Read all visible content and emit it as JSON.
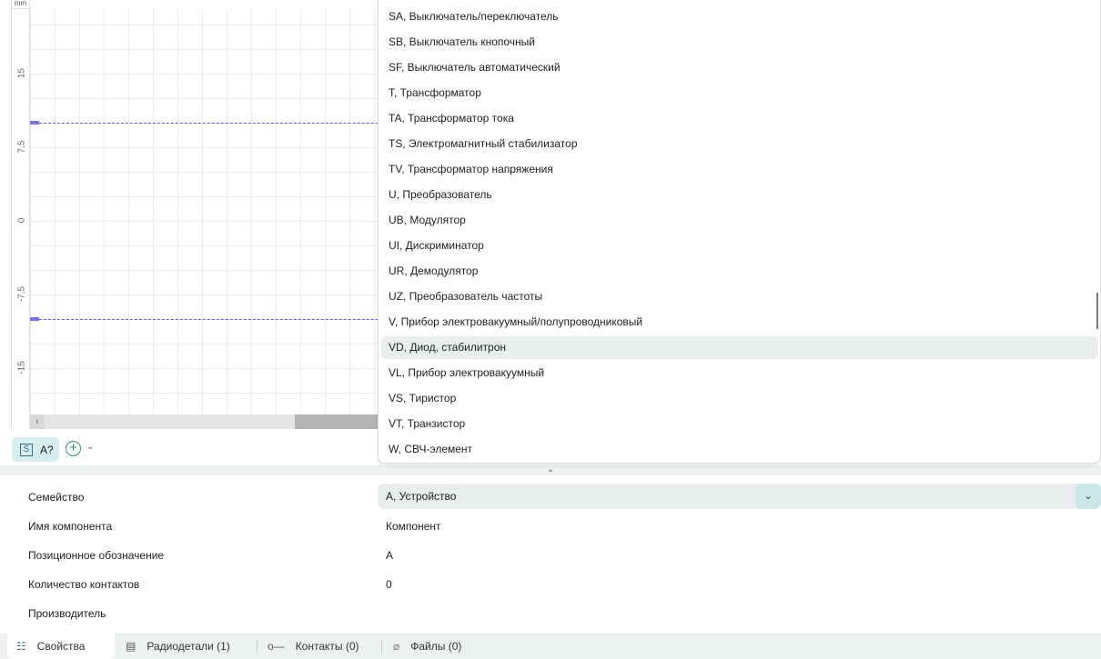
{
  "ruler": {
    "unit": "mm",
    "labels": [
      "15",
      "7,5",
      "0",
      "-7,5",
      "-15"
    ]
  },
  "toolbar": {
    "chip_icon": "S",
    "chip_label": "A?",
    "add_icon": "plus-circle-icon",
    "dropdown_icon": "chevron-down-icon"
  },
  "dropdown": {
    "items": [
      "SA, Выключатель/переключатель",
      "SB, Выключатель кнопочный",
      "SF, Выключатель автоматический",
      "T, Трансформатор",
      "TA, Трансформатор тока",
      "TS, Электромагнитный стабилизатор",
      "TV, Трансформатор напряжения",
      "U, Преобразователь",
      "UB, Модулятор",
      "UI, Дискриминатор",
      "UR, Демодулятор",
      "UZ, Преобразователь частоты",
      "V, Прибор электровакуумный/полупроводниковый",
      "VD, Диод, стабилитрон",
      "VL, Прибор электровакуумный",
      "VS, Тиристор",
      "VT, Транзистор",
      "W, СВЧ-элемент"
    ],
    "highlighted": "VD, Диод, стабилитрон"
  },
  "properties": {
    "family_label": "Семейство",
    "family_value": "А, Устройство",
    "name_label": "Имя компонента",
    "name_value": "Компонент",
    "designator_label": "Позиционное обозначение",
    "designator_value": "А",
    "pins_label": "Количество контактов",
    "pins_value": "0",
    "manufacturer_label": "Производитель",
    "manufacturer_value": ""
  },
  "tabs": [
    {
      "label": "Свойства",
      "icon": "sliders-icon"
    },
    {
      "label": "Радиодетали (1)",
      "icon": "chip-icon"
    },
    {
      "label": "Контакты (0)",
      "icon": "pin-icon"
    },
    {
      "label": "Файлы (0)",
      "icon": "paperclip-icon"
    }
  ],
  "colors": {
    "accent": "#cbe7ea",
    "guide": "#6a5cf0",
    "highlight": "#e9eded"
  }
}
